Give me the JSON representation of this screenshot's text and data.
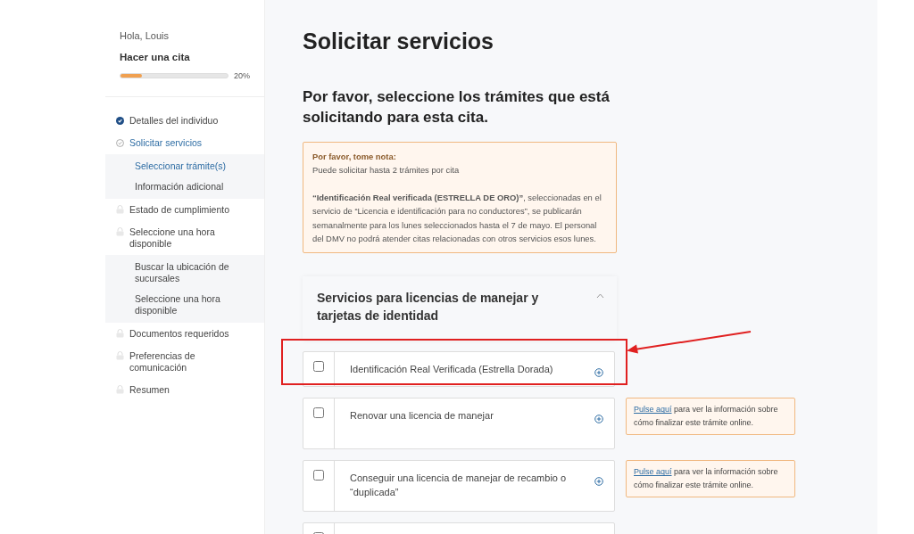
{
  "sidebar": {
    "greeting": "Hola, Louis",
    "title": "Hacer una cita",
    "progress": {
      "level": 0.2,
      "reading": "20%"
    },
    "steps": [
      {
        "label": "Detalles del individuo",
        "kind": "done",
        "selected": false
      },
      {
        "label": "Solicitar servicios",
        "kind": "current",
        "selected": true,
        "children": [
          {
            "label": "Seleccionar trámite(s)",
            "selected": true
          },
          {
            "label": "Información adicional",
            "selected": false
          }
        ]
      },
      {
        "label": "Estado de cumplimiento",
        "kind": "locked",
        "selected": false
      },
      {
        "label": "Seleccione una hora disponible",
        "kind": "locked",
        "selected": false,
        "children": [
          {
            "label": "Buscar la ubicación de sucursales",
            "selected": false
          },
          {
            "label": "Seleccione una hora disponible",
            "selected": false
          }
        ]
      },
      {
        "label": "Documentos requeridos",
        "kind": "locked",
        "selected": false
      },
      {
        "label": "Preferencias de comunicación",
        "kind": "locked",
        "selected": false
      },
      {
        "label": "Resumen",
        "kind": "locked",
        "selected": false
      }
    ]
  },
  "main": {
    "title": "Solicitar servicios",
    "subtitle": "Por favor, seleccione los trámites que está solicitando para esta cita.",
    "note": {
      "heading": "Por favor, tome nota:",
      "lines": [
        "Puede solicitar hasta 2 trámites por cita",
        "**“Identificación Real verificada (ESTRELLA DE ORO)”**, seleccionadas en el servicio de “Licencia e identificación para no conductores”, se publicarán semanalmente para los lunes seleccionados hasta el 7 de mayo. El personal del DMV no podrá atender citas relacionadas con otros servicios esos lunes."
      ]
    },
    "section": {
      "title": "Servicios para licencias de manejar y tarjetas de identidad",
      "expanded": true,
      "services": [
        {
          "label": "Identificación Real Verificada (Estrella Dorada)",
          "checked": false,
          "highlighted": true
        },
        {
          "label": "Renovar una licencia de manejar",
          "checked": false,
          "highlighted": false,
          "info": {
            "link": "Pulse aquí",
            "text": "para ver la información sobre cómo finalizar este trámite online."
          }
        },
        {
          "label": "Conseguir una licencia de manejar de recambio o “duplicada”",
          "checked": false,
          "highlighted": false,
          "info": {
            "link": "Pulse aquí",
            "text": "para ver la información sobre cómo finalizar este trámite online."
          }
        },
        {
          "checked": false,
          "highlighted": false
        }
      ]
    }
  }
}
